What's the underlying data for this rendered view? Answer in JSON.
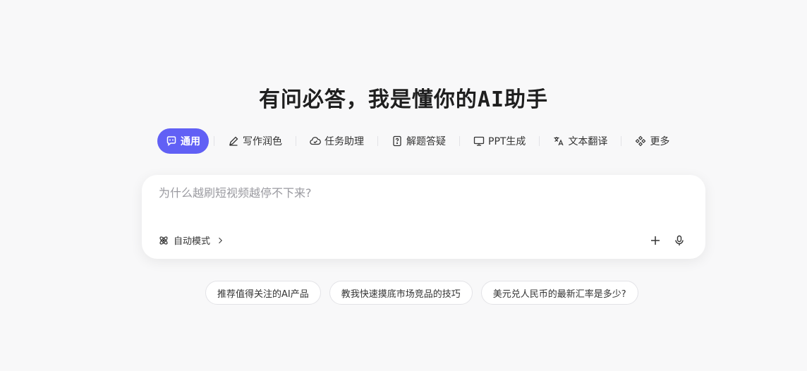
{
  "title": "有问必答，我是懂你的AI助手",
  "tabs": [
    {
      "label": "通用",
      "icon": "chat-bubble-icon",
      "active": true
    },
    {
      "label": "写作润色",
      "icon": "pen-icon"
    },
    {
      "label": "任务助理",
      "icon": "cloud-check-icon"
    },
    {
      "label": "解题答疑",
      "icon": "question-doc-icon"
    },
    {
      "label": "PPT生成",
      "icon": "monitor-icon"
    },
    {
      "label": "文本翻译",
      "icon": "translate-icon"
    },
    {
      "label": "更多",
      "icon": "grid-diamond-icon"
    }
  ],
  "input": {
    "placeholder": "为什么越刷短视频越停不下来?",
    "mode_label": "自动模式"
  },
  "suggestions": [
    "推荐值得关注的AI产品",
    "教我快速摸底市场竞品的技巧",
    "美元兑人民币的最新汇率是多少?"
  ],
  "colors": {
    "accent": "#6160f5",
    "background": "#f8f8f9"
  }
}
